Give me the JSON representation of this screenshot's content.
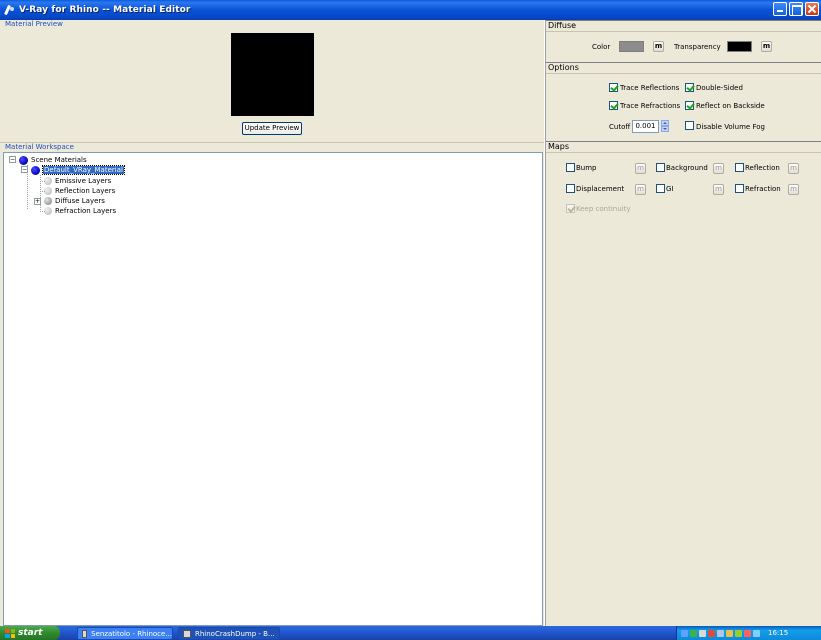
{
  "window": {
    "title": "V-Ray for Rhino -- Material Editor"
  },
  "preview": {
    "section_label": "Material Preview",
    "update_button": "Update Preview"
  },
  "workspace": {
    "section_label": "Material Workspace",
    "tree": {
      "root": "Scene Materials",
      "material": "Default_VRay_Material",
      "layers": [
        "Emissive Layers",
        "Reflection Layers",
        "Diffuse Layers",
        "Refraction Layers"
      ]
    }
  },
  "diffuse": {
    "header": "Diffuse",
    "color_label": "Color",
    "color_value": "#8c8c8c",
    "map_button": "m",
    "transparency_label": "Transparency",
    "transparency_value": "#000000"
  },
  "options": {
    "header": "Options",
    "trace_reflections": "Trace Reflections",
    "double_sided": "Double-Sided",
    "trace_refractions": "Trace Refractions",
    "reflect_on_backside": "Reflect on Backside",
    "cutoff_label": "Cutoff",
    "cutoff_value": "0.001",
    "disable_volume_fog": "Disable Volume Fog"
  },
  "maps": {
    "header": "Maps",
    "bump": "Bump",
    "background": "Background",
    "reflection": "Reflection",
    "displacement": "Displacement",
    "gi": "GI",
    "refraction": "Refraction",
    "keep_continuity": "Keep continuity",
    "map_button": "m"
  },
  "taskbar": {
    "start": "start",
    "tasks": [
      "Senzatitolo - Rhinoce...",
      "RhinoCrashDump - B..."
    ],
    "clock": "16:15"
  },
  "colors": {
    "title_bar": "#0953d6",
    "selection": "#316ac5",
    "section_label": "#1f4fbf",
    "checkmark": "#21a121"
  }
}
